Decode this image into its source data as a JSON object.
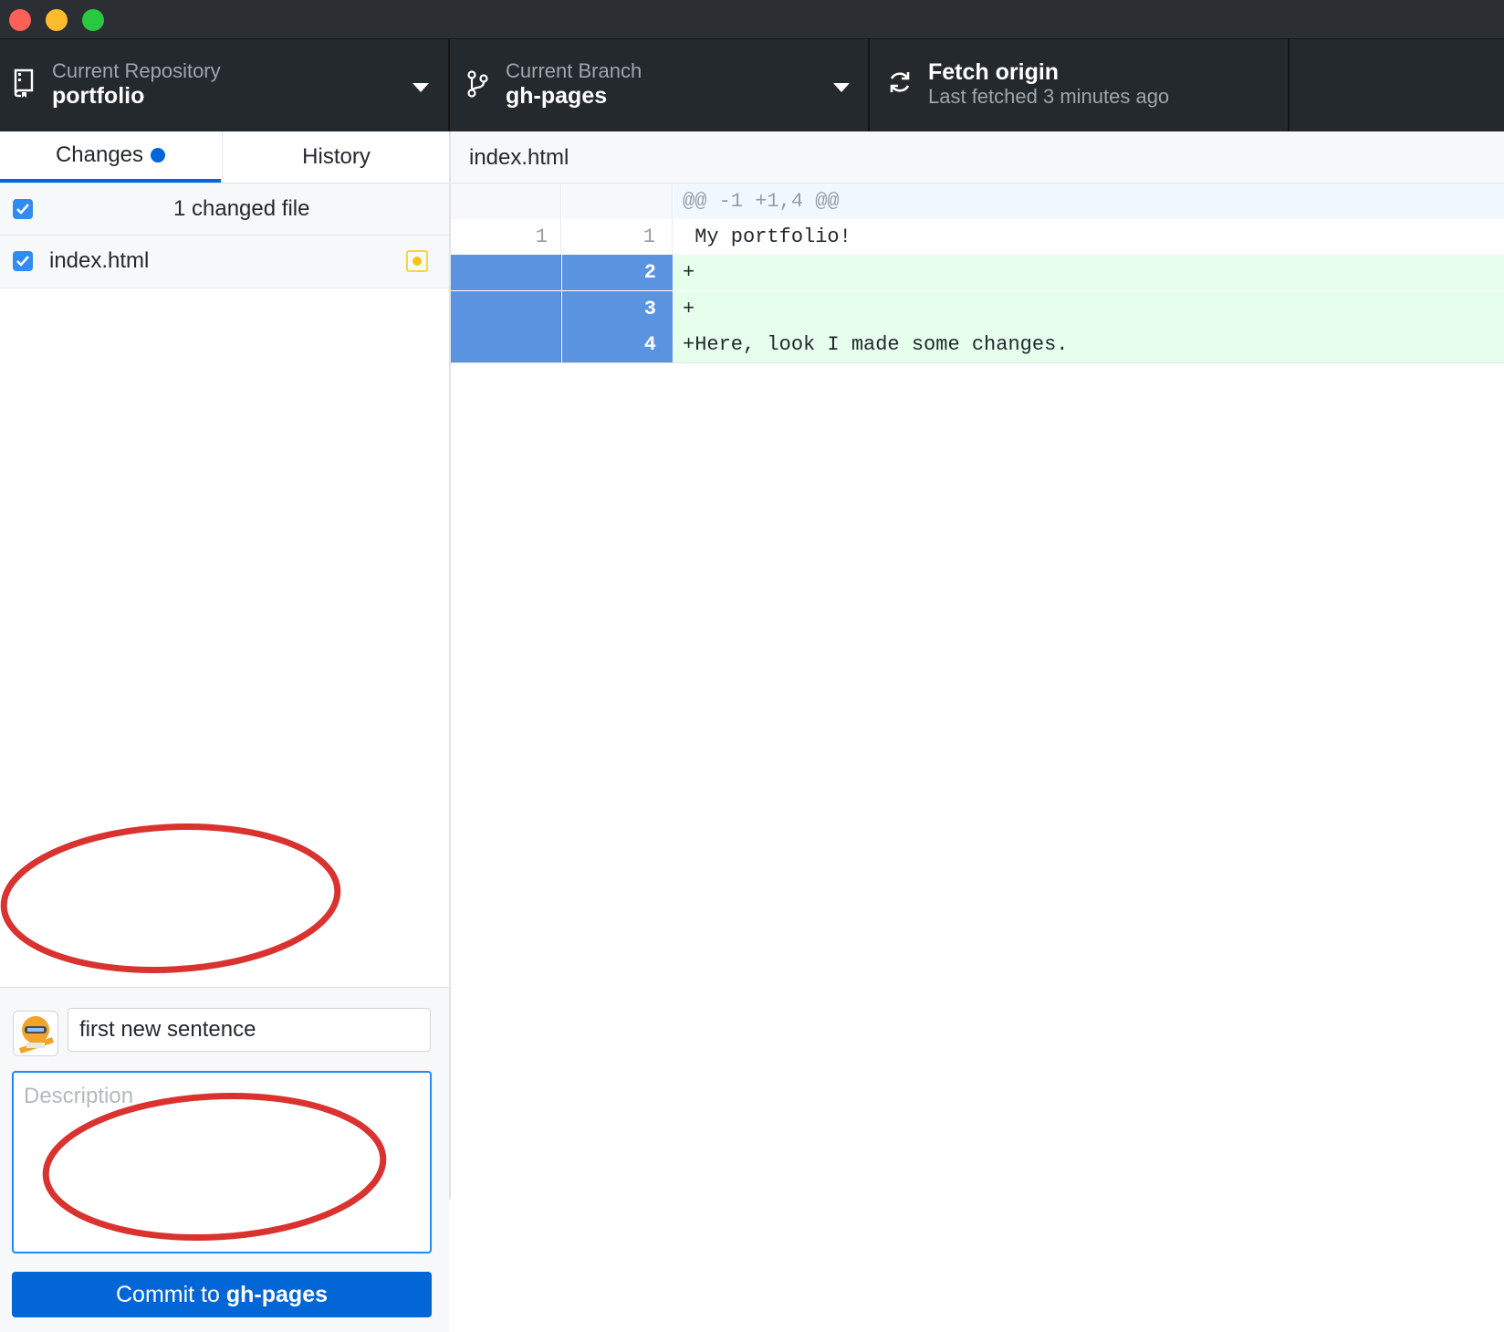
{
  "toolbar": {
    "repository": {
      "label": "Current Repository",
      "value": "portfolio"
    },
    "branch": {
      "label": "Current Branch",
      "value": "gh-pages"
    },
    "fetch": {
      "title": "Fetch origin",
      "subtitle": "Last fetched 3 minutes ago"
    }
  },
  "tabs": {
    "changes": "Changes",
    "history": "History"
  },
  "changes": {
    "summary": "1 changed file",
    "files": [
      {
        "name": "index.html",
        "status": "modified"
      }
    ]
  },
  "commit": {
    "summary_value": "first new sentence",
    "description_placeholder": "Description",
    "button_prefix": "Commit to",
    "button_branch": "gh-pages"
  },
  "diff": {
    "file": "index.html",
    "lines": [
      {
        "type": "hunk",
        "old": "",
        "new": "",
        "text": "@@ -1 +1,4 @@"
      },
      {
        "type": "context",
        "old": "1",
        "new": "1",
        "text": " My portfolio!"
      },
      {
        "type": "add",
        "old": "",
        "new": "2",
        "text": "+"
      },
      {
        "type": "add",
        "old": "",
        "new": "3",
        "text": "+"
      },
      {
        "type": "add",
        "old": "",
        "new": "4",
        "text": "+Here, look I made some changes."
      }
    ]
  },
  "colors": {
    "accent": "#0366d6",
    "annotation": "#d9322f",
    "added": "#e6ffed",
    "gutter_selected": "#5a94e0"
  }
}
